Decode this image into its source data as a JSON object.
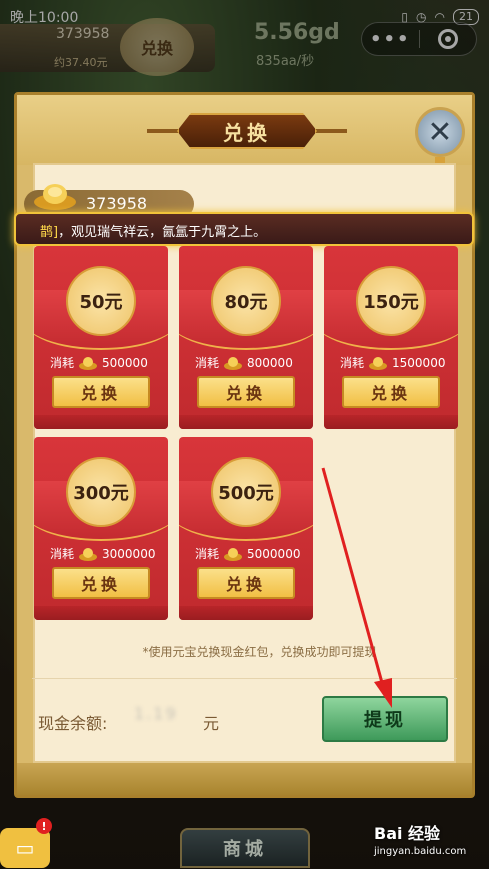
{
  "status_bar": {
    "time": "晚上10:00",
    "battery": "21"
  },
  "hud": {
    "gold": "373958",
    "rate": "约37.40元",
    "button": "兑换",
    "big_value": "5.56gd",
    "per_second": "835aa/秒"
  },
  "modal": {
    "title": "兑换",
    "close_icon": "close-icon",
    "balance": "373958",
    "marquee_highlight": "鹊]",
    "marquee_text": "，观见瑞气祥云，氤氲于九霄之上。",
    "cards": [
      {
        "amount": "50元",
        "cost_label": "消耗",
        "cost": "500000",
        "button": "兑换"
      },
      {
        "amount": "80元",
        "cost_label": "消耗",
        "cost": "800000",
        "button": "兑换"
      },
      {
        "amount": "150元",
        "cost_label": "消耗",
        "cost": "1500000",
        "button": "兑换"
      },
      {
        "amount": "300元",
        "cost_label": "消耗",
        "cost": "3000000",
        "button": "兑换"
      },
      {
        "amount": "500元",
        "cost_label": "消耗",
        "cost": "5000000",
        "button": "兑换"
      }
    ],
    "hint": "*使用元宝兑换现金红包，兑换成功即可提现",
    "cash_label": "现金余额:",
    "cash_value": "1.19",
    "cash_unit": "元",
    "withdraw_button": "提现"
  },
  "bottom": {
    "shop_tab": "商城",
    "badge": "!",
    "watermark": "Bai 经验",
    "watermark_url": "jingyan.baidu.com"
  },
  "colors": {
    "card_red": "#d8353a",
    "gold_button": "#f1bf44",
    "withdraw_green": "#3e9a5a",
    "annotation_arrow": "#e02020"
  }
}
